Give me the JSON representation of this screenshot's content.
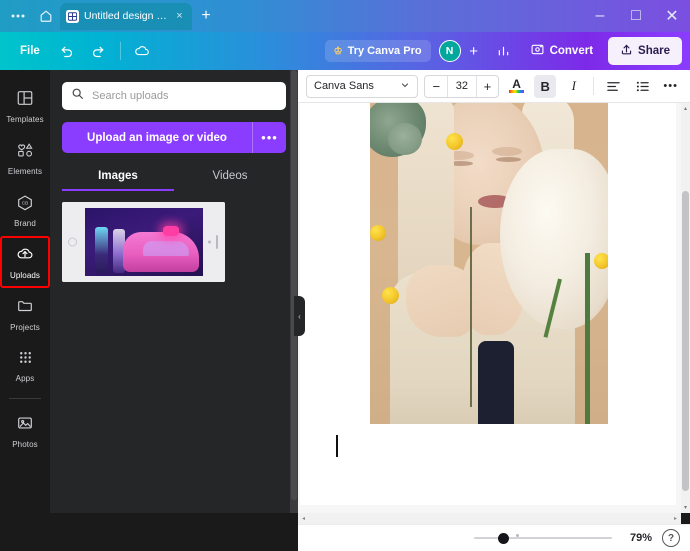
{
  "browser": {
    "menu_icon": "ellipsis-icon",
    "home_icon": "home-icon",
    "tab": {
      "favicon": "canva-favicon",
      "title": "Untitled design - D...",
      "close_label": "×"
    },
    "new_tab_label": "+",
    "window_controls": {
      "minimize": "–",
      "maximize": "□",
      "close": "✕"
    }
  },
  "header": {
    "file_label": "File",
    "undo_icon": "undo-icon",
    "redo_icon": "redo-icon",
    "cloud_icon": "cloud-save-icon",
    "try_pro": {
      "label": "Try Canva Pro",
      "icon": "crown-icon"
    },
    "avatar_initial": "N",
    "add_member_label": "+",
    "analytics_icon": "bar-chart-icon",
    "convert": {
      "label": "Convert",
      "icon": "convert-icon"
    },
    "share": {
      "label": "Share",
      "icon": "share-upload-icon"
    }
  },
  "rail": {
    "items": [
      {
        "label": "Templates",
        "icon": "templates-icon",
        "active": false
      },
      {
        "label": "Elements",
        "icon": "elements-icon",
        "active": false
      },
      {
        "label": "Brand",
        "icon": "brand-icon",
        "active": false
      },
      {
        "label": "Uploads",
        "icon": "uploads-icon",
        "active": true
      },
      {
        "label": "Projects",
        "icon": "projects-folder-icon",
        "active": false
      },
      {
        "label": "Apps",
        "icon": "apps-grid-icon",
        "active": false
      },
      {
        "label": "Photos",
        "icon": "photos-icon",
        "active": false
      }
    ]
  },
  "panel": {
    "search": {
      "placeholder": "Search uploads",
      "value": "",
      "icon": "search-icon"
    },
    "upload_button": {
      "label": "Upload an image or video",
      "more_label": "•••"
    },
    "tabs": [
      {
        "label": "Images",
        "active": true
      },
      {
        "label": "Videos",
        "active": false
      }
    ],
    "thumbnail_name": "phone-neon-car-upload-thumbnail"
  },
  "collapse_handle": {
    "icon": "chevron-left-icon",
    "glyph": "‹"
  },
  "toolbar": {
    "font_family": "Canva Sans",
    "font_dropdown_icon": "chevron-down-icon",
    "font_size": "32",
    "decrease_label": "−",
    "increase_label": "+",
    "text_color": {
      "glyph": "A",
      "icon": "text-color-icon"
    },
    "bold": {
      "glyph": "B",
      "active": true
    },
    "italic": {
      "glyph": "I",
      "active": false
    },
    "align_icon": "text-align-left-icon",
    "list_icon": "bullet-list-icon",
    "more_icon": "more-options-icon",
    "more_glyph": "•••"
  },
  "canvas": {
    "page_name": "design-page-1",
    "photo_alt": "portrait-photo-woman-with-white-flowers",
    "text_caret": "text-cursor"
  },
  "status": {
    "zoom_percent": "79%",
    "help_glyph": "?",
    "scroll_left_glyph": "◂",
    "scroll_right_glyph": "▸",
    "scroll_up_glyph": "▴",
    "scroll_down_glyph": "▾"
  },
  "colors": {
    "canva_purple": "#8b3dff",
    "canva_teal": "#00c4cc",
    "highlight_red": "#ff0000",
    "panel_bg": "#252627",
    "rail_bg": "#1a1a1a"
  }
}
